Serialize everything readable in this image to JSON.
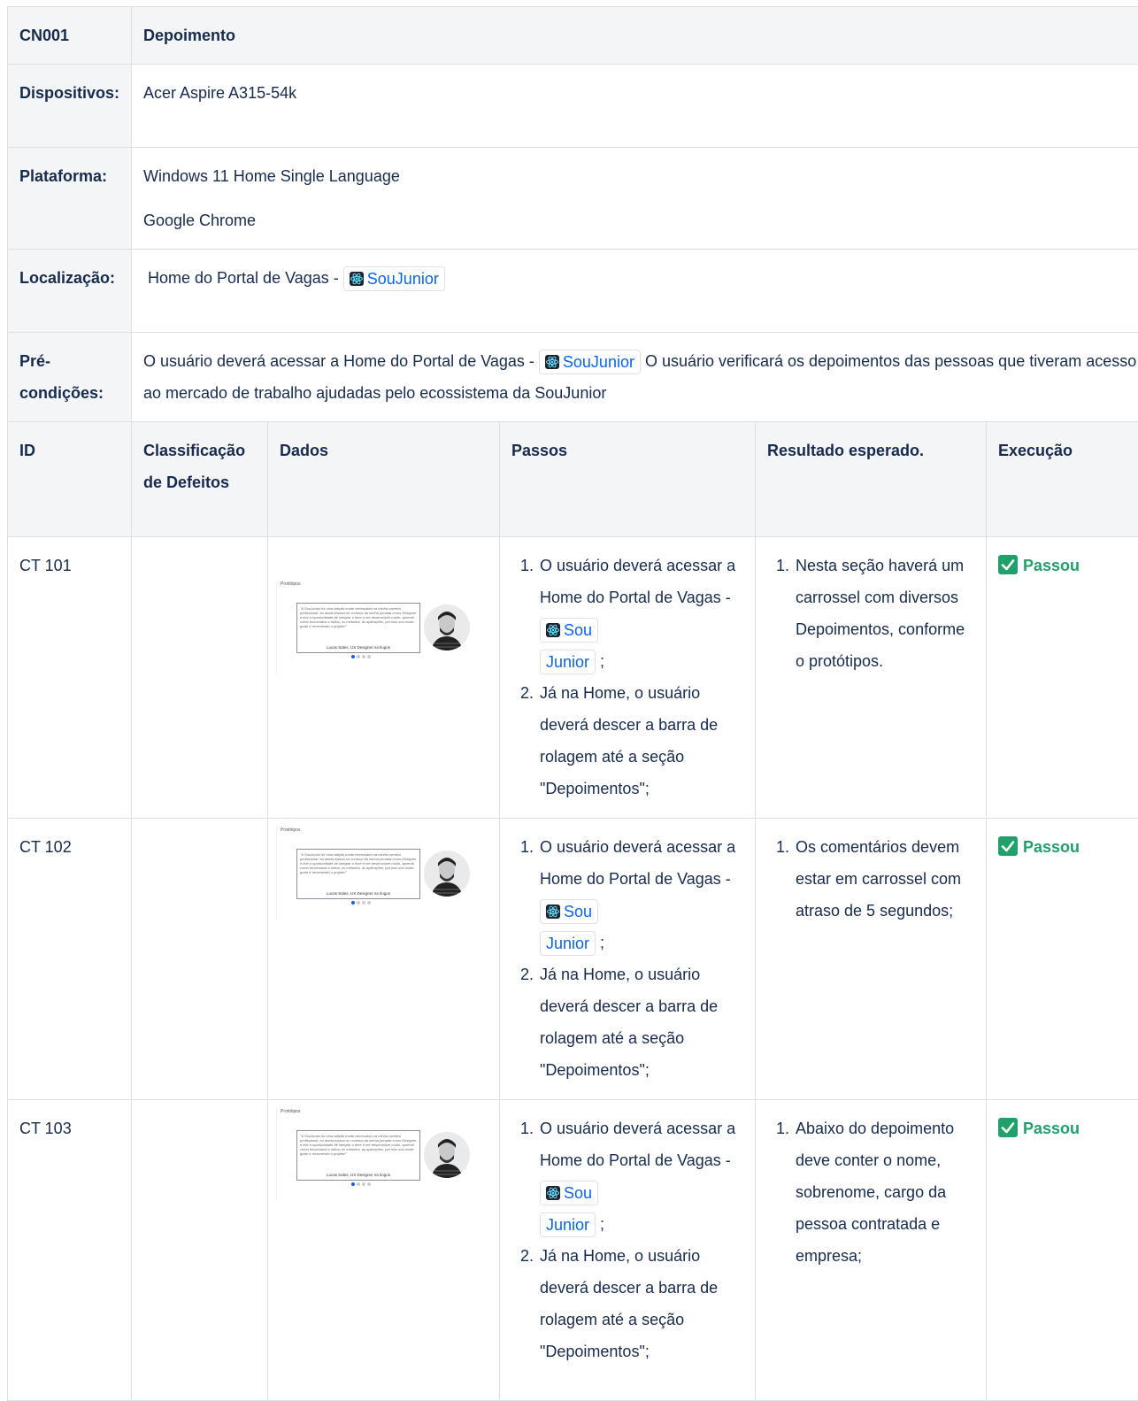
{
  "header": {
    "id": "CN001",
    "title": "Depoimento"
  },
  "info": [
    {
      "label": "Dispositivos:",
      "lines": [
        "Acer Aspire A315-54k"
      ]
    },
    {
      "label": "Plataforma:",
      "lines": [
        "Windows 11 Home Single Language",
        "Google Chrome"
      ]
    },
    {
      "label": "Localização:",
      "prefix": "Home do Portal de Vagas - ",
      "link": "SouJunior"
    },
    {
      "label": "Pré-condições:",
      "prefix": "O usuário deverá acessar a Home do Portal de Vagas - ",
      "link": "SouJunior",
      "suffix": " O usuário verificará os depoimentos das pessoas que tiveram acesso ao mercado de trabalho ajudadas pelo ecossistema da SouJunior"
    }
  ],
  "columns": [
    "ID",
    "Classificação de Defeitos",
    "Dados",
    "Passos",
    "Resultado esperado.",
    "Execução"
  ],
  "thumbnail": {
    "title": "Protótipos",
    "quote": "\"A SouJunior foi uma adição muito necessária na minha carreira profissional, eu ainda estava no começo da minha jornada como Designer e tive a oportunidade de integrar o time e me desenvolver muito, aprendi como funcionava a rotina, os métodos, as aplicações, por isso sou muito grato e recomendo o projeto!\"",
    "author": "Lucas Sales, UX Designer na Ilogos"
  },
  "rows": [
    {
      "id": "CT 101",
      "classification": "",
      "step1_prefix": "O usuário deverá acessar a Home do Portal de Vagas - ",
      "step1_link_a": "Sou",
      "step1_link_b": "Junior",
      "step1_suffix": " ;",
      "step2": " Já na Home, o usuário deverá descer a barra de rolagem até a seção \"Depoimentos\";",
      "expected": "Nesta seção haverá um carrossel com diversos Depoimentos, conforme o protótipos.",
      "status": "Passou"
    },
    {
      "id": "CT 102",
      "classification": "",
      "step1_prefix": "O usuário deverá acessar a Home do Portal de Vagas - ",
      "step1_link_a": "Sou",
      "step1_link_b": "Junior",
      "step1_suffix": " ;",
      "step2": " Já na Home, o usuário deverá descer a barra de rolagem até a seção \"Depoimentos\";",
      "expected": "Os comentários devem estar em carrossel com atraso de 5 segundos;",
      "status": "Passou"
    },
    {
      "id": "CT 103",
      "classification": "",
      "step1_prefix": "O usuário deverá acessar a Home do Portal de Vagas - ",
      "step1_link_a": "Sou",
      "step1_link_b": "Junior",
      "step1_suffix": " ;",
      "step2": " Já na Home, o usuário deverá descer a barra de rolagem até a seção \"Depoimentos\";",
      "expected": "Abaixo do depoimento deve conter o nome, sobrenome, cargo da pessoa contratada e empresa;",
      "status": "Passou"
    }
  ],
  "colors": {
    "link": "#0c66e4",
    "pass": "#22a06b",
    "header_bg": "#f4f5f7",
    "border": "#dcdfe4"
  },
  "icons": {
    "link": "react-icon",
    "status": "check-icon",
    "avatar": "avatar-photo"
  }
}
